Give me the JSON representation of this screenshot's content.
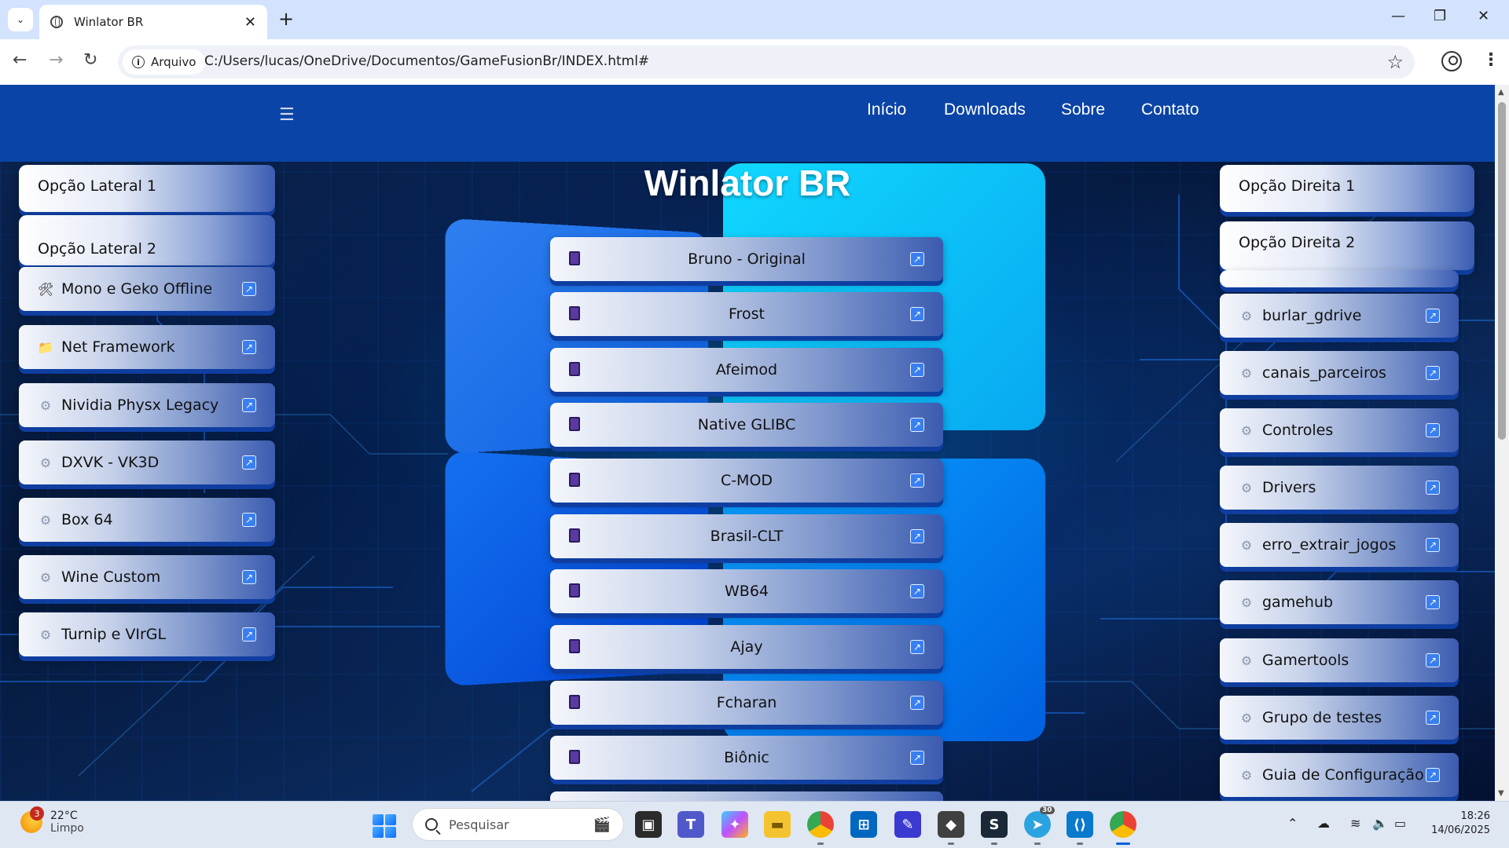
{
  "browser": {
    "tab_title": "Winlator BR",
    "close_glyph": "✕",
    "new_tab_glyph": "+",
    "site_chip": "Arquivo",
    "url": "C:/Users/lucas/OneDrive/Documentos/GameFusionBr/INDEX.html#",
    "back_glyph": "←",
    "forward_glyph": "→",
    "reload_glyph": "↻",
    "star_glyph": "☆",
    "menu_glyph": "⋮",
    "minimize_glyph": "—",
    "restore_glyph": "❐",
    "window_close_glyph": "✕",
    "tab_menu_glyph": "⌄"
  },
  "site": {
    "hamburger": "☰",
    "nav": [
      "Início",
      "Downloads",
      "Sobre",
      "Contato"
    ],
    "title": "Winlator BR",
    "left_options": [
      "Opção Lateral 1",
      "Opção Lateral 2"
    ],
    "left_links": [
      {
        "label": "Mono e Geko Offline",
        "icon": "tools-icon"
      },
      {
        "label": "Net Framework",
        "icon": "folder-icon"
      },
      {
        "label": "Nividia Physx Legacy",
        "icon": "gear-icon"
      },
      {
        "label": "DXVK - VK3D",
        "icon": "gear-icon"
      },
      {
        "label": "Box 64",
        "icon": "gear-icon"
      },
      {
        "label": "Wine Custom",
        "icon": "gear-icon"
      },
      {
        "label": "Turnip e VIrGL",
        "icon": "gear-icon"
      }
    ],
    "center_links": [
      "Bruno - Original",
      "Frost",
      "Afeimod",
      "Native GLIBC",
      "C-MOD",
      "Brasil-CLT",
      "WB64",
      "Ajay",
      "Fcharan",
      "Biônic"
    ],
    "right_options": [
      "Opção Direita 1",
      "Opção Direita 2"
    ],
    "right_links": [
      "burlar_gdrive",
      "canais_parceiros",
      " Controles",
      "Drivers",
      "erro_extrair_jogos",
      "gamehub",
      "Gamertools",
      "Grupo de testes",
      "Guia de Configuração"
    ],
    "ext_glyph": "↗"
  },
  "taskbar": {
    "weather_temp": "22°C",
    "weather_desc": "Limpo",
    "weather_badge": "3",
    "search_placeholder": "Pesquisar",
    "time": "18:26",
    "date": "14/06/2025",
    "telegram_badge": "30"
  },
  "colors": {
    "header_bg": "#0a44a6",
    "accent": "#0a5fd8"
  }
}
